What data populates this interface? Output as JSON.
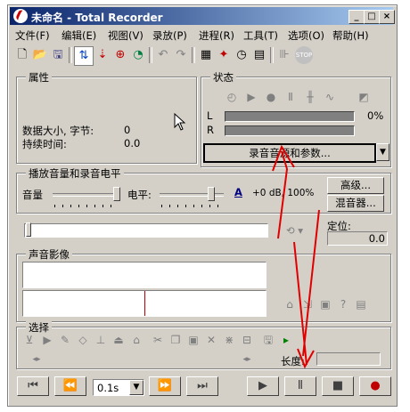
{
  "window": {
    "title": "未命名 - Total Recorder"
  },
  "menu": [
    "文件(F)",
    "编辑(E)",
    "视图(V)",
    "录放(P)",
    "进程(R)",
    "工具(T)",
    "选项(O)",
    "帮助(H)"
  ],
  "toolbar": {
    "icons": [
      "new-file-icon",
      "open-folder-icon",
      "save-icon",
      "record-source-icon",
      "playback-icon",
      "scheduler-icon",
      "clock-icon",
      "undo-icon",
      "redo-icon",
      "properties-icon",
      "effects-icon",
      "timer-icon",
      "calendar-icon",
      "split-icon",
      "stop-sign-icon"
    ]
  },
  "properties": {
    "title": "属性",
    "size_label": "数据大小, 字节:",
    "size_value": "0",
    "duration_label": "持续时间:",
    "duration_value": "0.0"
  },
  "status": {
    "title": "状态",
    "left_label": "L",
    "right_label": "R",
    "percent": "0%",
    "source_button": "录音音源和参数..."
  },
  "levels": {
    "title": "播放音量和录音电平",
    "volume_label": "音量",
    "level_label": "电平:",
    "level_value": "+0 dB, 100%",
    "advanced_button": "高级...",
    "mixer_button": "混音器..."
  },
  "position": {
    "label": "定位:",
    "value": "0.0"
  },
  "waveform": {
    "title": "声音影像"
  },
  "selection": {
    "title": "选择",
    "length_label": "长度:"
  },
  "transport": {
    "speed_value": "0.1s"
  }
}
